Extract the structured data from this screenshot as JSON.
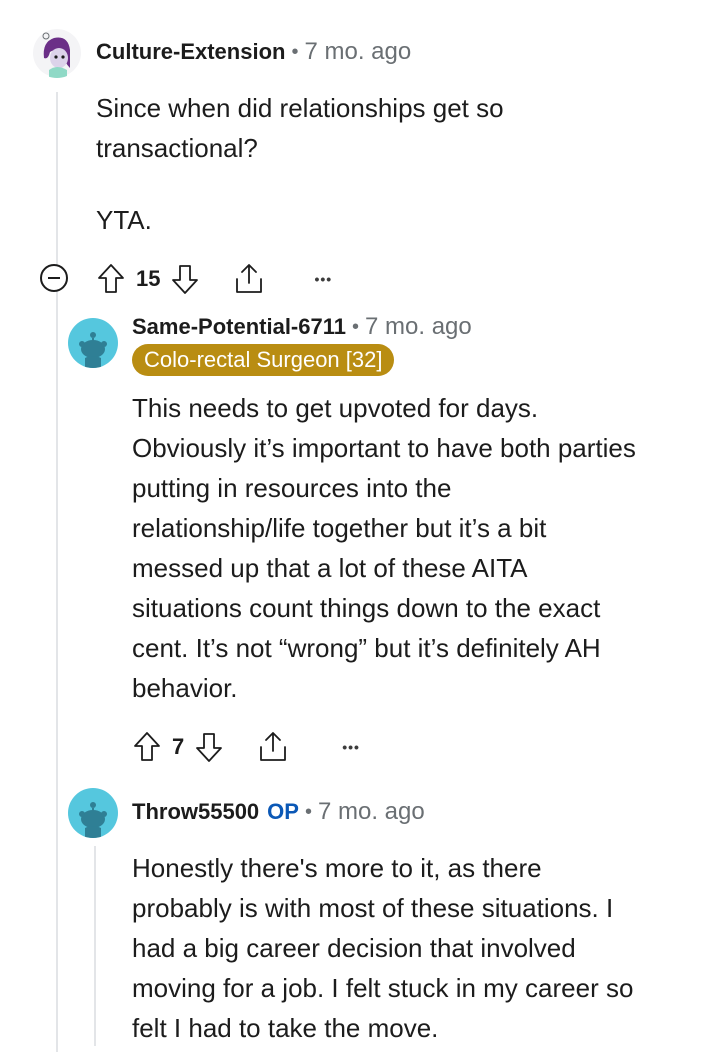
{
  "comments": [
    {
      "username": "Culture-Extension",
      "time": "7 mo. ago",
      "body": [
        "Since when did relationships get so",
        "transactional?",
        "",
        "YTA."
      ],
      "votes": "15"
    },
    {
      "username": "Same-Potential-6711",
      "time": "7 mo. ago",
      "flair": "Colo-rectal Surgeon [32]",
      "body": [
        "This needs to get upvoted for days.",
        "Obviously it’s important to have both parties",
        "putting in resources into the",
        "relationship/life together but it’s a bit",
        "messed up that a lot of these AITA",
        "situations count things down to the exact",
        "cent. It’s not “wrong” but it’s definitely AH",
        "behavior."
      ],
      "votes": "7"
    },
    {
      "username": "Throw55500",
      "op_badge": "OP",
      "time": "7 mo. ago",
      "body": [
        "Honestly there's more to it, as there",
        "probably is with most of these situations. I",
        "had a big career decision that involved",
        "moving for a job. I felt stuck in my career so",
        "felt I had to take the move."
      ]
    }
  ],
  "separator": "•",
  "more_glyph": "•••",
  "colors": {
    "flair_bg": "#b98d12",
    "op": "#0b58b6",
    "snoo_bg": "#55c7de"
  }
}
